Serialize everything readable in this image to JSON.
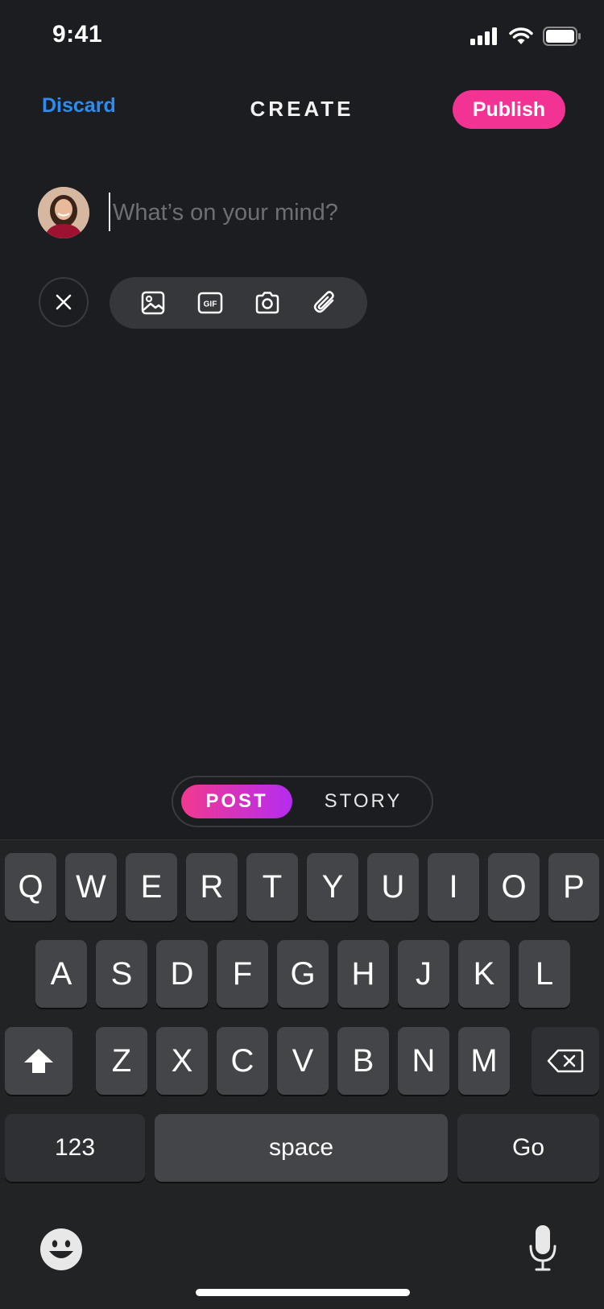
{
  "status_bar": {
    "time": "9:41"
  },
  "header": {
    "discard_label": "Discard",
    "title": "CREATE",
    "publish_label": "Publish"
  },
  "composer": {
    "placeholder": "What’s on your mind?"
  },
  "attachments": {
    "icons": [
      "image-icon",
      "gif-icon",
      "camera-icon",
      "paperclip-icon"
    ],
    "gif_text": "GIF"
  },
  "mode_toggle": {
    "post_label": "POST",
    "story_label": "STORY",
    "selected": "POST"
  },
  "keyboard": {
    "row1": [
      "Q",
      "W",
      "E",
      "R",
      "T",
      "Y",
      "U",
      "I",
      "O",
      "P"
    ],
    "row2": [
      "A",
      "S",
      "D",
      "F",
      "G",
      "H",
      "J",
      "K",
      "L"
    ],
    "row3": [
      "Z",
      "X",
      "C",
      "V",
      "B",
      "N",
      "M"
    ],
    "numbers_label": "123",
    "space_label": "space",
    "go_label": "Go"
  },
  "colors": {
    "accent": "#f23393",
    "link": "#2d8cf0",
    "background": "#1c1d20"
  }
}
